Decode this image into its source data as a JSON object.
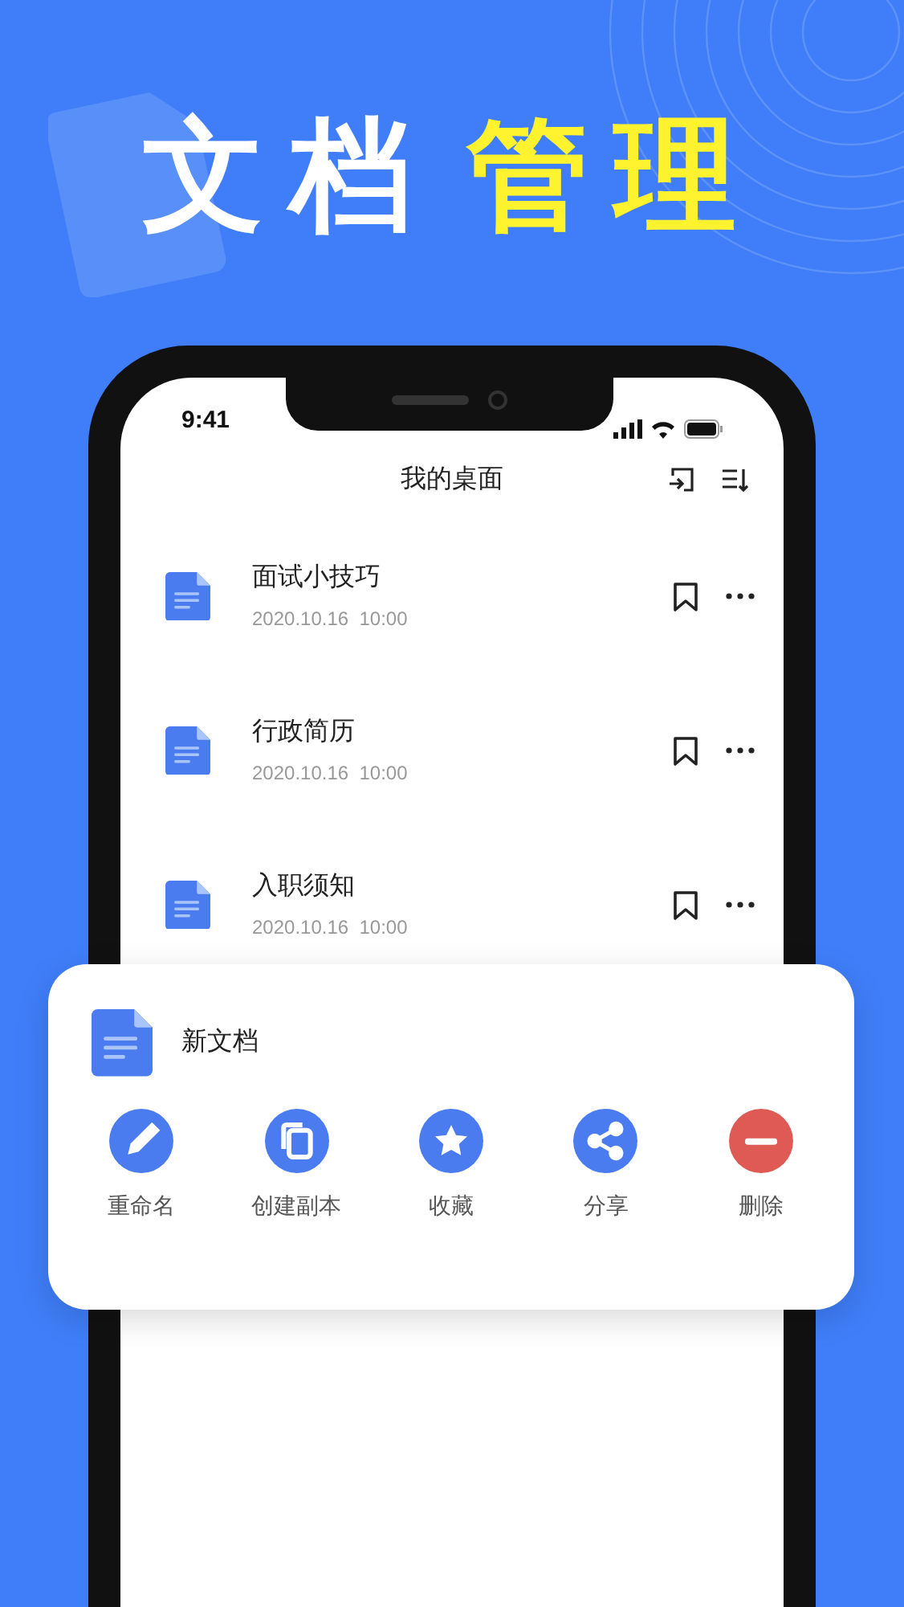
{
  "headline": [
    {
      "text": "文档",
      "kind": "plain"
    },
    {
      "text": "管理",
      "kind": "highlight"
    }
  ],
  "status_bar": {
    "time": "9:41"
  },
  "screen": {
    "title": "我的桌面"
  },
  "documents": [
    {
      "name": "面试小技巧",
      "date": "2020.10.16  10:00"
    },
    {
      "name": "行政简历",
      "date": "2020.10.16  10:00"
    },
    {
      "name": "入职须知",
      "date": "2020.10.16  10:00"
    }
  ],
  "action_sheet": {
    "document_name": "新文档",
    "actions": [
      {
        "label": "重命名",
        "kind": "rename",
        "color": "#4a7cf0"
      },
      {
        "label": "创建副本",
        "kind": "copy",
        "color": "#4a7cf0"
      },
      {
        "label": "收藏",
        "kind": "favorite",
        "color": "#4a7cf0"
      },
      {
        "label": "分享",
        "kind": "share",
        "color": "#4a7cf0"
      },
      {
        "label": "删除",
        "kind": "delete",
        "color": "#e05a55"
      }
    ]
  }
}
